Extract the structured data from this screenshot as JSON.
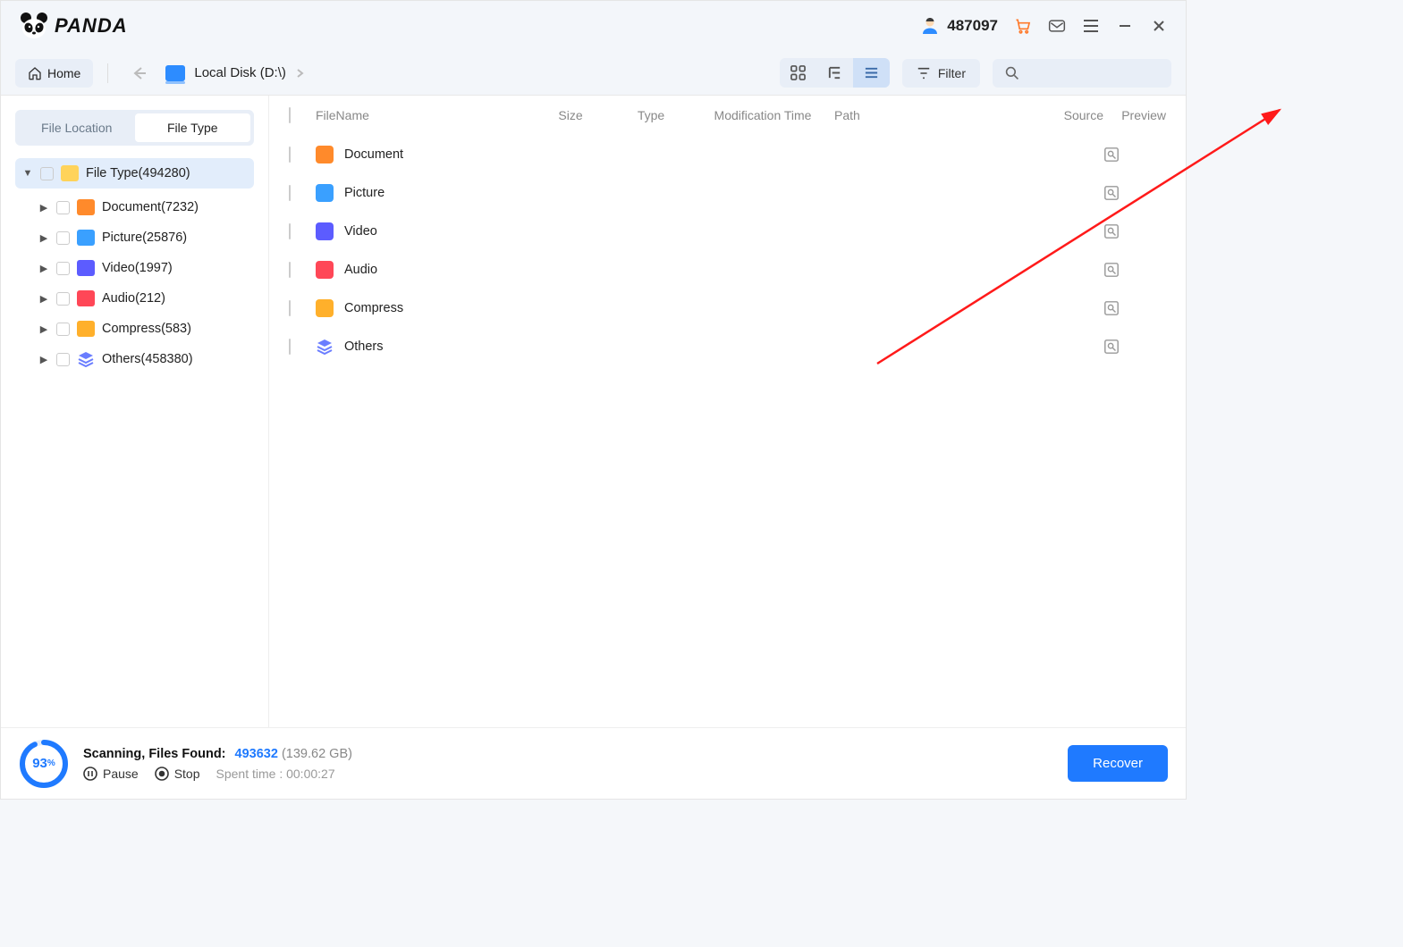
{
  "titlebar": {
    "brand": "PANDA",
    "user_id": "487097"
  },
  "toolbar": {
    "home_label": "Home",
    "breadcrumb_label": "Local Disk (D:\\)",
    "filter_label": "Filter"
  },
  "sidebar": {
    "tabs": {
      "location": "File Location",
      "type": "File Type"
    },
    "root": {
      "label": "File Type(494280)"
    },
    "items": [
      {
        "label": "Document(7232)",
        "icon": "ic-doc"
      },
      {
        "label": "Picture(25876)",
        "icon": "ic-pic"
      },
      {
        "label": "Video(1997)",
        "icon": "ic-vid"
      },
      {
        "label": "Audio(212)",
        "icon": "ic-aud"
      },
      {
        "label": "Compress(583)",
        "icon": "ic-zip"
      },
      {
        "label": "Others(458380)",
        "icon": "ic-oth"
      }
    ]
  },
  "columns": {
    "name": "FileName",
    "size": "Size",
    "type": "Type",
    "mtime": "Modification Time",
    "path": "Path",
    "source": "Source",
    "preview": "Preview"
  },
  "rows": [
    {
      "name": "Document",
      "icon": "ic-doc"
    },
    {
      "name": "Picture",
      "icon": "ic-pic"
    },
    {
      "name": "Video",
      "icon": "ic-vid"
    },
    {
      "name": "Audio",
      "icon": "ic-aud"
    },
    {
      "name": "Compress",
      "icon": "ic-zip"
    },
    {
      "name": "Others",
      "icon": "ic-oth"
    }
  ],
  "status": {
    "percent": "93",
    "label": "Scanning, Files Found:",
    "count": "493632",
    "size": "(139.62 GB)",
    "pause": "Pause",
    "stop": "Stop",
    "spent": "Spent time : 00:00:27",
    "recover": "Recover"
  }
}
